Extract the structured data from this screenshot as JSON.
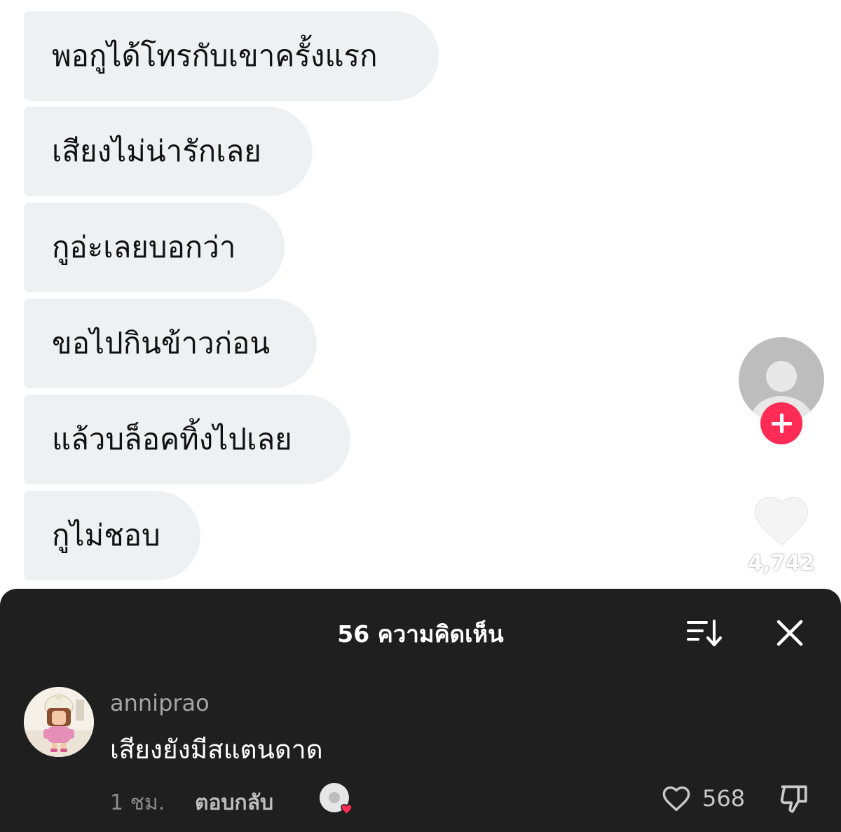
{
  "video": {
    "messages": [
      "พอกูได้โทรกับเขาครั้งแรก",
      "เสียงไม่น่ารักเลย",
      "กูอ่ะเลยบอกว่า",
      "ขอไปกินข้าวก่อน",
      "แล้วบล็อคทิ้งไปเลย",
      "กูไม่ชอบ"
    ],
    "like_count": "4,742"
  },
  "comments_sheet": {
    "title": "56 ความคิดเห็น",
    "comment": {
      "username": "anniprao",
      "text": "เสียงยังมีสแตนดาด",
      "time": "1 ชม.",
      "reply_label": "ตอบกลับ",
      "like_count": "568"
    }
  },
  "colors": {
    "bubble": "#eef1f4",
    "sheet_background": "#1f1f1f",
    "follow_accent": "#fe2c55"
  },
  "icons": [
    "person-icon",
    "plus-icon",
    "heart-icon",
    "sort-icon",
    "close-icon",
    "creator-liked-heart-icon",
    "dislike-icon"
  ]
}
